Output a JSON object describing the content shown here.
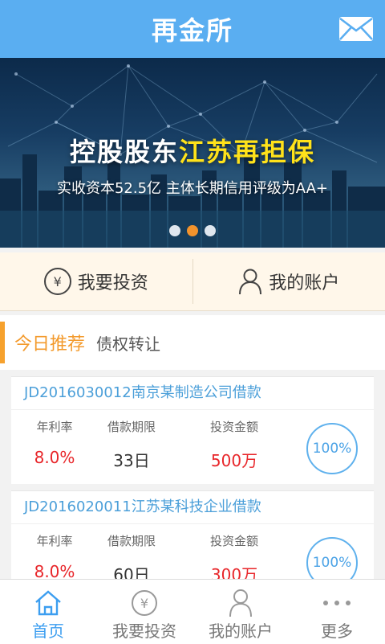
{
  "header": {
    "title": "再金所"
  },
  "banner": {
    "headline_prefix": "控股股东",
    "headline_highlight": "江苏再担保",
    "subline": "实收资本52.5亿 主体长期信用评级为AA+",
    "dots": 3,
    "active_dot": 1
  },
  "quick": {
    "invest_label": "我要投资",
    "account_label": "我的账户"
  },
  "tabs": {
    "active": "今日推荐",
    "other": "债权转让"
  },
  "loans": [
    {
      "title": "JD2016030012南京某制造公司借款",
      "rate_label": "年利率",
      "rate": "8.0%",
      "term_label": "借款期限",
      "term": "33日",
      "amount_label": "投资金额",
      "amount": "500万",
      "progress": "100%"
    },
    {
      "title": "JD2016020011江苏某科技企业借款",
      "rate_label": "年利率",
      "rate": "8.0%",
      "term_label": "借款期限",
      "term": "60日",
      "amount_label": "投资金额",
      "amount": "300万",
      "progress": "100%"
    }
  ],
  "nav": {
    "home": "首页",
    "invest": "我要投资",
    "account": "我的账户",
    "more": "更多"
  },
  "colors": {
    "brand": "#5aaef1",
    "accent": "#f39a2c",
    "red": "#e8262a"
  }
}
